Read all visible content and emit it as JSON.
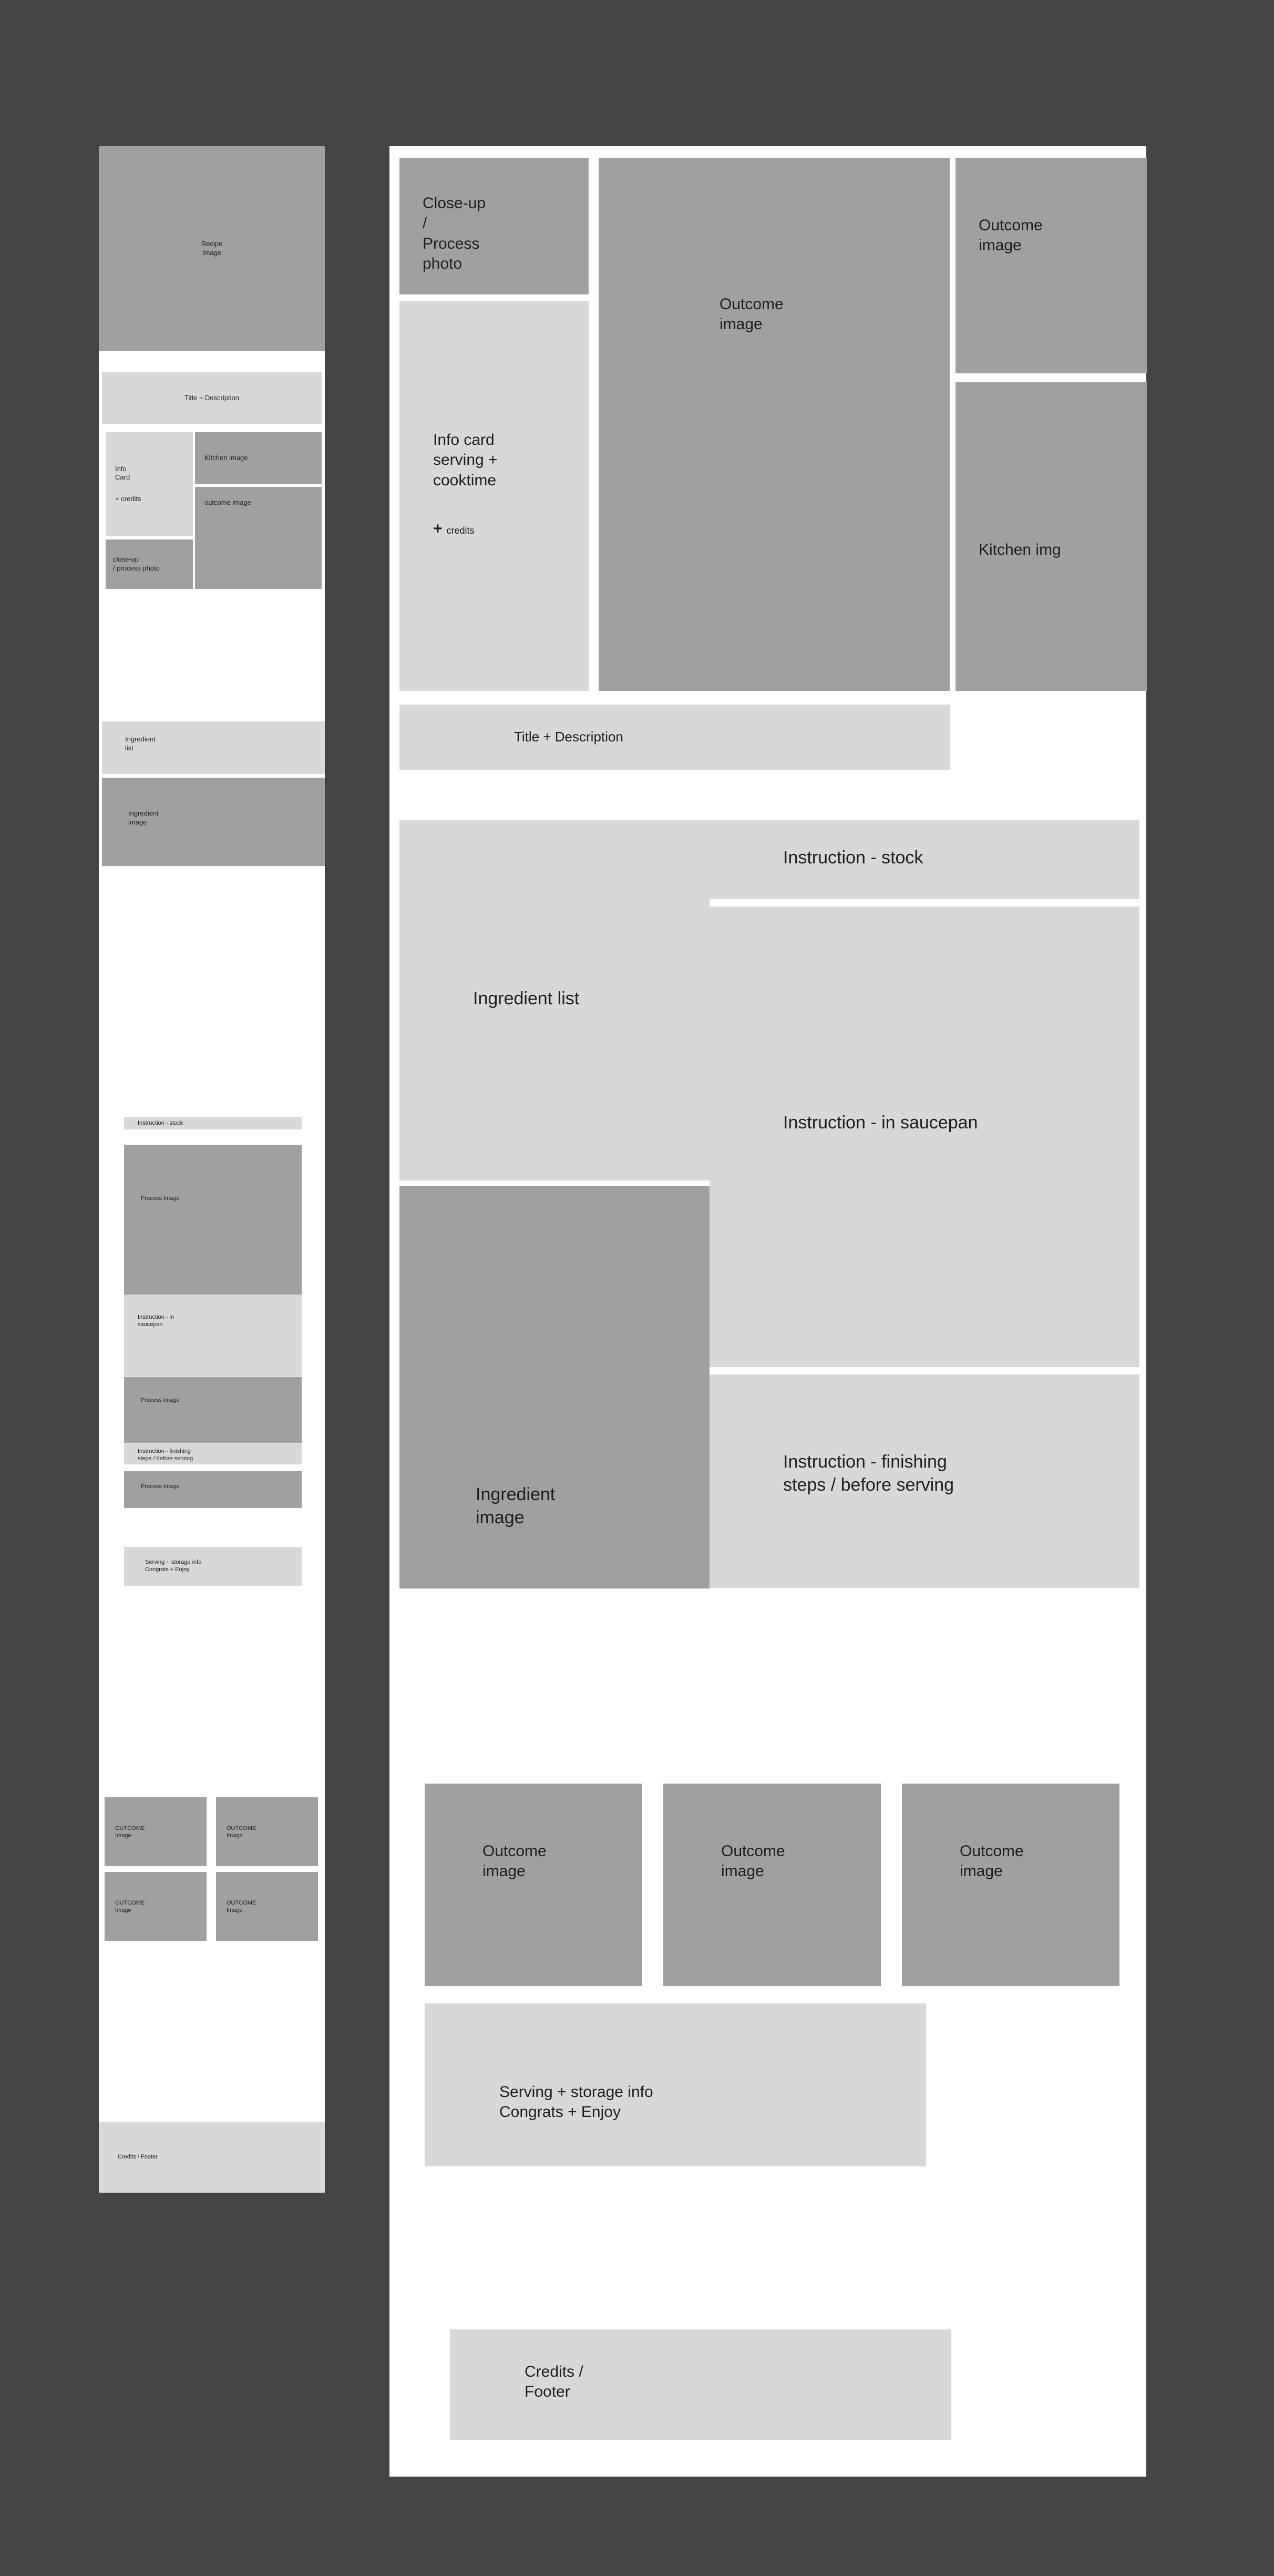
{
  "meta": {
    "background_color": "#444444",
    "panel_color": "#ffffff",
    "image_placeholder_color": "#a0a0a0",
    "text_placeholder_color": "#d8d8d8",
    "label_color": "#1f1f1f"
  },
  "mobile": {
    "blocks": {
      "recipe_image": "Recipe\nImage",
      "title_description": "Title + Description",
      "info_card": "Info\nCard",
      "info_card_credits": "+ credits",
      "kitchen_image": "Kitchen image",
      "outcome_image": "outcome image",
      "closeup_process_photo": "close-up\n/ process photo",
      "ingredient_list": "Ingredient\nlist",
      "ingredient_image": "Ingredient\nimage",
      "instruction_stock": "Instruction - stock",
      "process_image_1": "Process Image",
      "instruction_saucepan": "Instruction - in\nsaucepan",
      "process_image_2": "Process Image",
      "instruction_finishing": "Instruction - finishing\nsteps / before serving",
      "process_image_3": "Process Image",
      "serving_storage": "Serving + storage info\nCongrats + Enjoy",
      "outcome_grid": [
        "OUTCOME\nImage",
        "OUTCOME\nImage",
        "OUTCOME\nImage",
        "OUTCOME\nImage"
      ],
      "credits_footer": "Credits  / Footer"
    }
  },
  "desktop": {
    "blocks": {
      "closeup_process_photo": "Close-up\n/\nProcess\nphoto",
      "outcome_image_hero": "Outcome\nimage",
      "outcome_image_right": "Outcome\nimage",
      "kitchen_img": "Kitchen img",
      "info_card": "Info card\nserving +\ncooktime",
      "info_card_credits_plus": "+",
      "info_card_credits_word": "credits",
      "title_description": "Title + Description",
      "ingredient_list": "Ingredient list",
      "ingredient_image": "Ingredient\nimage",
      "instruction_stock": "Instruction - stock",
      "instruction_saucepan": "Instruction - in saucepan",
      "instruction_finishing": "Instruction - finishing\nsteps / before serving",
      "outcome_row": [
        "Outcome\nimage",
        "Outcome\nimage",
        "Outcome\nimage"
      ],
      "serving_storage": "Serving + storage info\nCongrats + Enjoy",
      "credits_footer": "Credits /\nFooter"
    }
  }
}
